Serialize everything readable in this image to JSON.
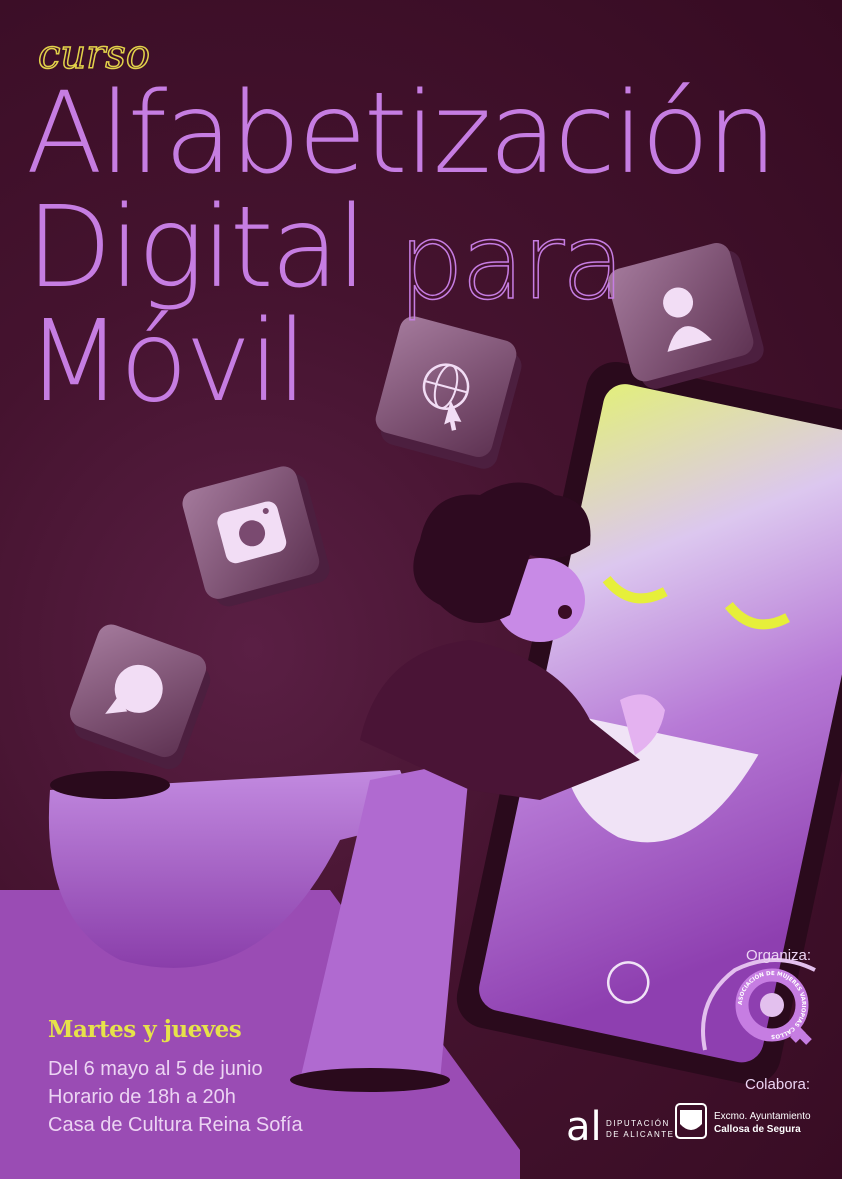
{
  "header": {
    "kicker": "curso",
    "title_line1": "Alfabetización",
    "title_line2": "Digital",
    "title_para": "para",
    "title_line3": "Móvil"
  },
  "details": {
    "days": "Martes y jueves",
    "dates": "Del 6 mayo al 5 de junio",
    "schedule": "Horario de 18h a 20h",
    "venue": "Casa de Cultura Reina Sofía"
  },
  "credits": {
    "organiza_label": "Organiza:",
    "organizer_logo_text": "ASOCIACIÓN DE MUJERES VARIOPIAS CALLOSA DE SEGURA",
    "colabora_label": "Colabora:",
    "diputacion_line1": "DIPUTACIÓN",
    "diputacion_line2": "DE ALICANTE",
    "ayto_line1": "Excmo. Ayuntamiento",
    "ayto_line2": "Callosa de Segura"
  },
  "icons": [
    "person-icon",
    "globe-cursor-icon",
    "camera-icon",
    "chat-bubble-icon",
    "home-button-icon"
  ],
  "colors": {
    "background": "#3a0d25",
    "title": "#c67de2",
    "accent_yellow": "#e6e24a",
    "floor": "#9a4cb4"
  }
}
